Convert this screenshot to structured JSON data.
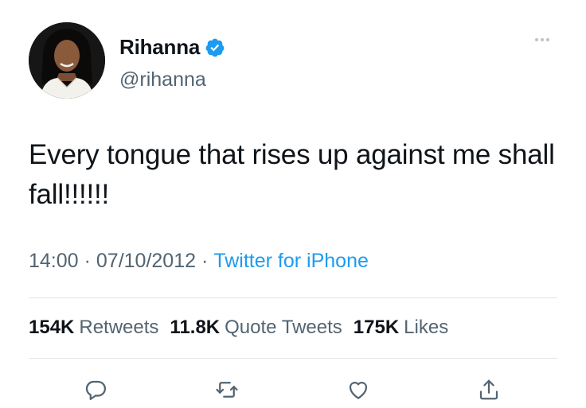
{
  "tweet": {
    "display_name": "Rihanna",
    "handle": "@rihanna",
    "text": "Every tongue that rises up against me shall fall!!!!!!",
    "time": "14:00",
    "date": "07/10/2012",
    "source": "Twitter for iPhone",
    "separator": "·"
  },
  "stats": {
    "retweets_count": "154K",
    "retweets_label": "Retweets",
    "quotes_count": "11.8K",
    "quotes_label": "Quote Tweets",
    "likes_count": "175K",
    "likes_label": "Likes"
  },
  "colors": {
    "accent": "#1d9bf0",
    "secondary_text": "#536471",
    "primary_text": "#0f1419"
  },
  "icons": [
    "verified-badge-icon",
    "more-icon",
    "reply-icon",
    "retweet-icon",
    "like-icon",
    "share-icon"
  ]
}
